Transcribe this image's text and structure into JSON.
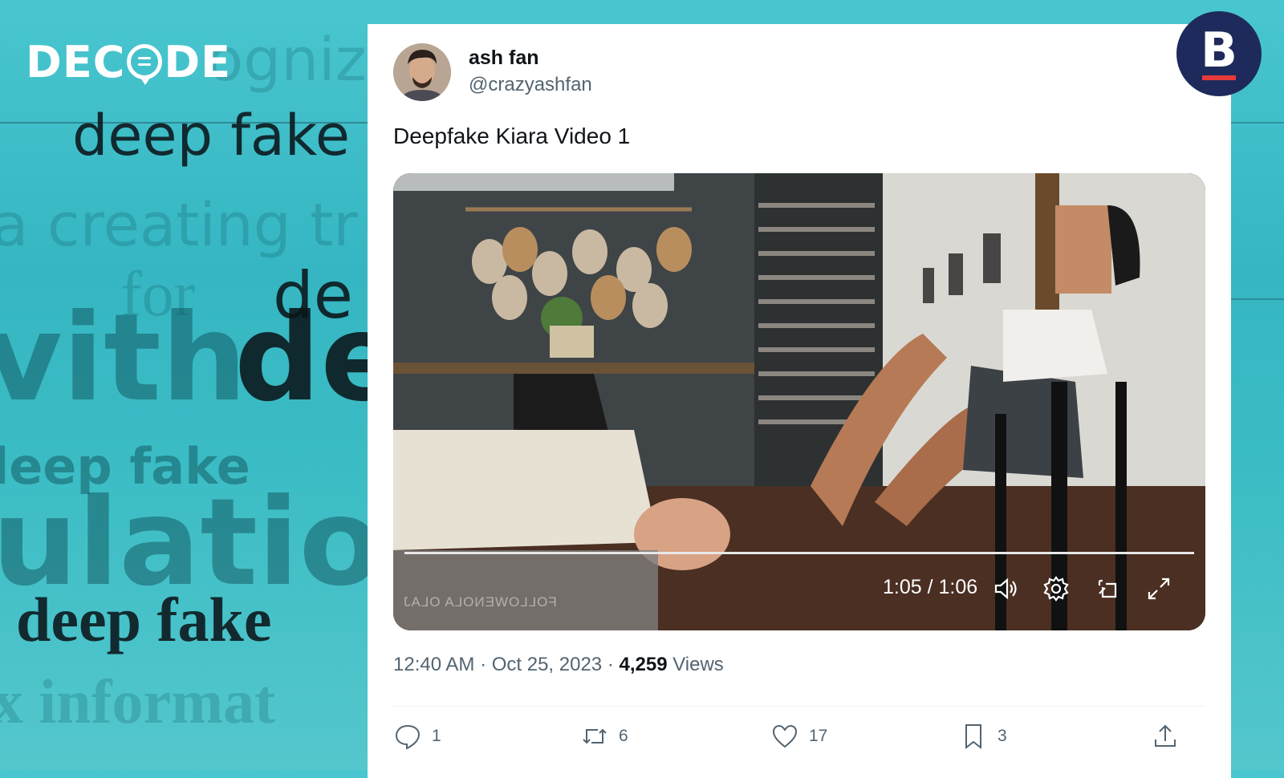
{
  "background": {
    "words": [
      "ognize",
      "deep fake",
      "a creating tr",
      "for",
      "de",
      "vith",
      "de",
      "leep fake",
      "ulation",
      "deep fake",
      "x informat"
    ],
    "accent_color": "#3bbcc4"
  },
  "logo": {
    "text_left": "DEC",
    "text_right": "DE",
    "icon": "speech-bubble-icon"
  },
  "badge": {
    "letter": "B",
    "bg_color": "#1f2a5c",
    "bar_color": "#e63a3a"
  },
  "tweet": {
    "author_name": "ash fan",
    "author_handle": "@crazyashfan",
    "text": "Deepfake Kiara Video 1",
    "video": {
      "time": "1:05 / 1:06",
      "watermark": "FOLLOWENOLA OLAJ",
      "progress": 0.98
    },
    "timestamp": "12:40 AM · Oct 25, 2023",
    "sep": " · ",
    "views_count": "4,259",
    "views_label": "Views",
    "actions": {
      "reply_count": "1",
      "retweet_count": "6",
      "like_count": "17",
      "bookmark_count": "3"
    }
  }
}
